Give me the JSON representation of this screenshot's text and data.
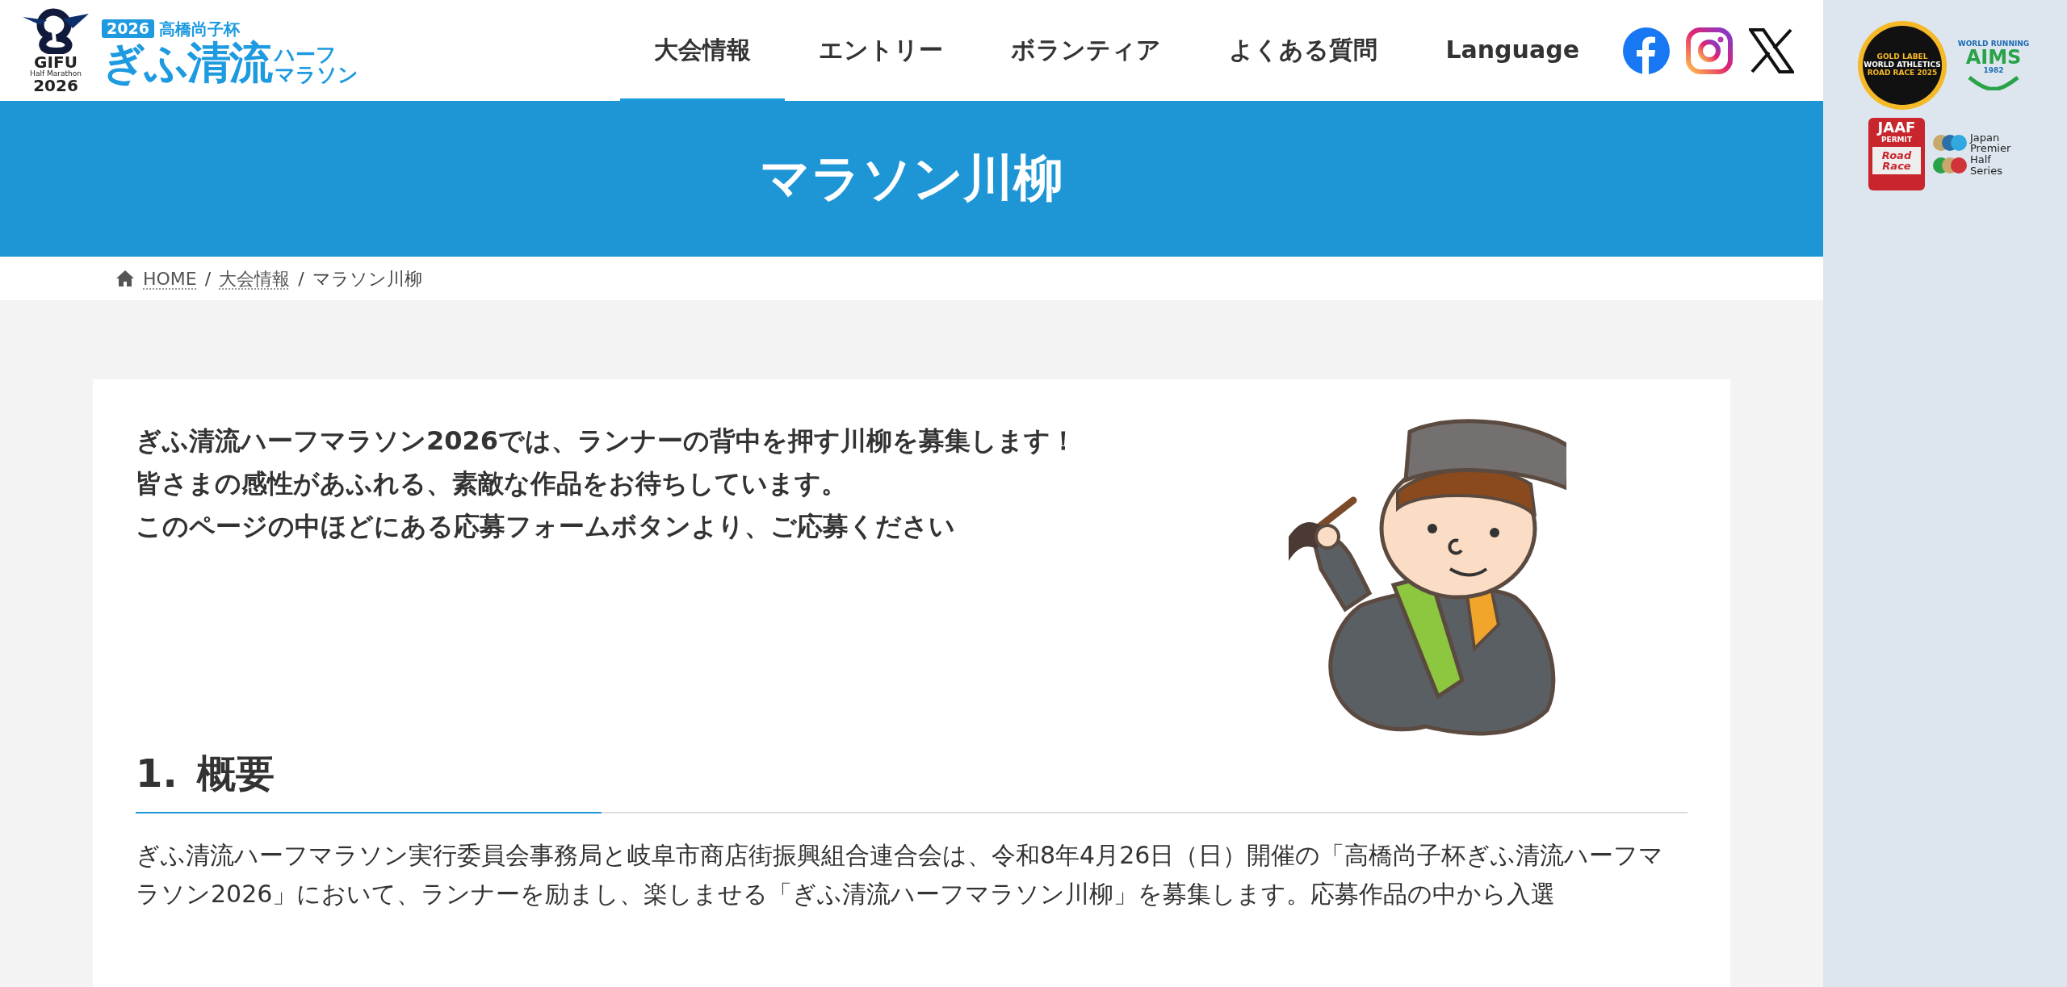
{
  "header": {
    "logo": {
      "year_badge": "2026",
      "cup": "高橋尚子杯",
      "name": "ぎふ清流",
      "suffix_top": "ハーフ",
      "suffix_bottom": "マラソン",
      "emblem_name": "GIFU",
      "emblem_sub": "Half Marathon",
      "emblem_year": "2026"
    },
    "nav": [
      {
        "label": "大会情報",
        "selected": true
      },
      {
        "label": "エントリー",
        "selected": false
      },
      {
        "label": "ボランティア",
        "selected": false
      },
      {
        "label": "よくある質問",
        "selected": false
      },
      {
        "label": "Language",
        "selected": false
      }
    ],
    "social": [
      {
        "kind": "facebook"
      },
      {
        "kind": "instagram"
      },
      {
        "kind": "x"
      }
    ]
  },
  "badges": [
    {
      "kind": "world-athletics",
      "texts": [
        "GOLD LABEL",
        "WORLD ATHLETICS",
        "ROAD RACE 2025"
      ]
    },
    {
      "kind": "aims",
      "texts": [
        "WORLD RUNNING",
        "AIMS",
        "1982"
      ]
    },
    {
      "kind": "jaaf",
      "texts": [
        "JAAF",
        "PERMIT",
        "Road Race"
      ]
    },
    {
      "kind": "premier",
      "texts": [
        "Japan",
        "Premier",
        "Half",
        "Series"
      ]
    }
  ],
  "banner": {
    "title": "マラソン川柳"
  },
  "breadcrumb_separator": "/",
  "breadcrumb": [
    {
      "label": "HOME",
      "kind": "home",
      "link": true
    },
    {
      "label": "大会情報",
      "kind": "page",
      "link": true
    },
    {
      "label": "マラソン川柳",
      "kind": "page",
      "link": false
    }
  ],
  "intro": [
    "ぎふ清流ハーフマラソン2026では、ランナーの背中を押す川柳を募集します！",
    "皆さまの感性があふれる、素敵な作品をお待ちしています。",
    "このページの中ほどにある応募フォームボタンより、ご応募ください"
  ],
  "sections": [
    {
      "number": "1.",
      "title": "概要",
      "paragraph": "ぎふ清流ハーフマラソン実行委員会事務局と岐阜市商店街振興組合連合会は、令和8年4月26日（日）開催の「高橋尚子杯ぎふ清流ハーフマラソン2026」において、ランナーを励まし、楽しませる「ぎふ清流ハーフマラソン川柳」を募集します。応募作品の中から入選"
    }
  ]
}
